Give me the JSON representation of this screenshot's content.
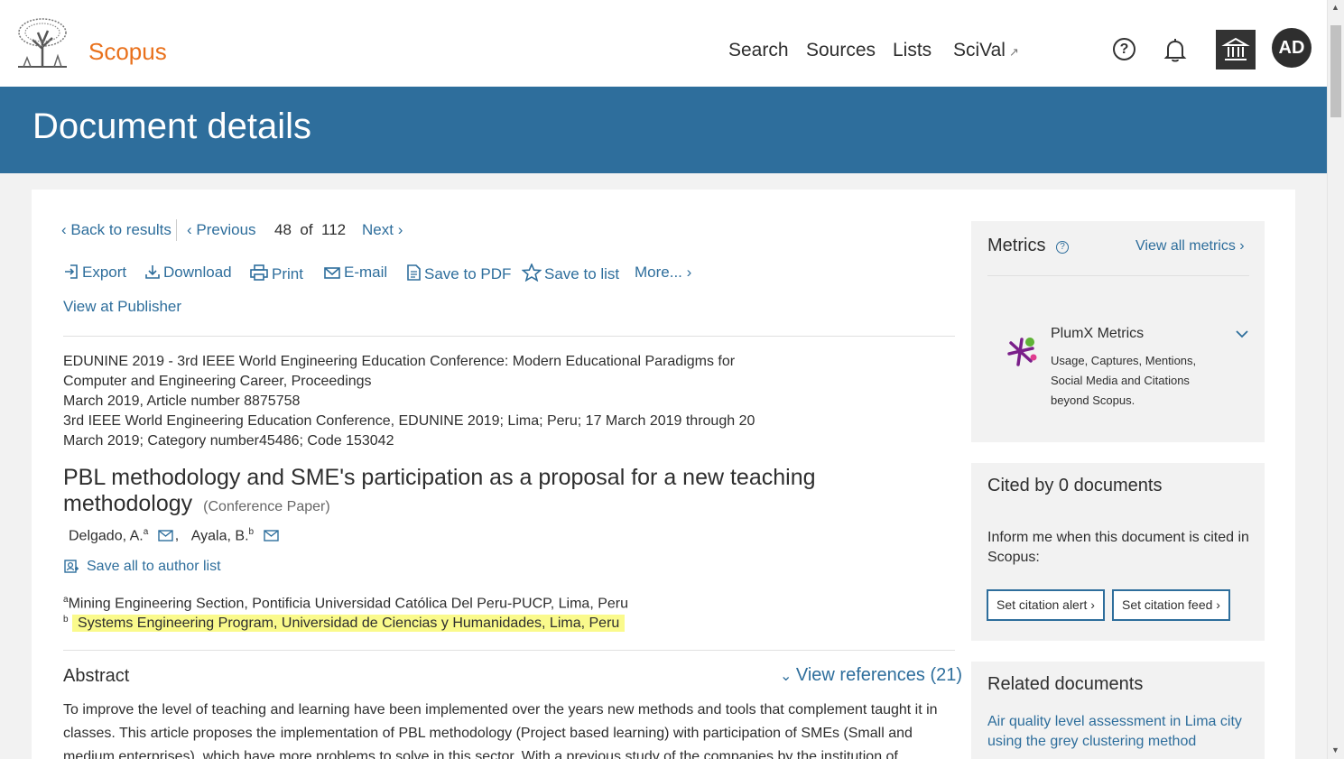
{
  "header": {
    "brand": "Scopus",
    "nav": {
      "search": "Search",
      "sources": "Sources",
      "lists": "Lists",
      "scival": "SciVal"
    },
    "avatar_initials": "AD",
    "icons": [
      "help-icon",
      "bell-icon",
      "institution-icon"
    ]
  },
  "banner": {
    "title": "Document details"
  },
  "results_nav": {
    "back": "Back to results",
    "previous": "Previous",
    "position": "48",
    "of": "of",
    "total": "112",
    "next": "Next"
  },
  "toolbar": {
    "export": "Export",
    "download": "Download",
    "print": "Print",
    "email": "E-mail",
    "save_pdf": "Save to PDF",
    "save_list": "Save to list",
    "more": "More..."
  },
  "view_publisher": "View at Publisher",
  "source": {
    "line1": "EDUNINE 2019 - 3rd IEEE World Engineering Education Conference: Modern Educational Paradigms for",
    "line2": "Computer and Engineering Career, Proceedings",
    "line3": "March 2019, Article number 8875758",
    "line4": "3rd IEEE World Engineering Education Conference, EDUNINE 2019; Lima; Peru; 17 March 2019 through 20",
    "line5": "March 2019; Category number45486; Code 153042"
  },
  "document": {
    "title_line1": "PBL methodology and SME's participation as a proposal for a new teaching",
    "title_line2": "methodology",
    "type": "(Conference Paper)"
  },
  "authors": [
    {
      "name": "Delgado, A.",
      "sup": "a"
    },
    {
      "name": "Ayala, B.",
      "sup": "b"
    }
  ],
  "save_author": "Save all to author list",
  "affiliations": [
    {
      "sup": "a",
      "text": "Mining Engineering Section, Pontificia Universidad Católica Del Peru-PUCP, Lima, Peru"
    },
    {
      "sup": "b",
      "text": "Systems Engineering Program, Universidad de Ciencias y Humanidades, Lima, Peru"
    }
  ],
  "abstract": {
    "heading": "Abstract",
    "view_refs": "View references (21)",
    "line1": "To improve the level of teaching and learning have been implemented over the years new methods and tools that complement taught it in",
    "line2": "classes. This article proposes the implementation of PBL methodology (Project based learning) with participation of SMEs (Small and",
    "line3": "medium enterprises), which have more problems to solve in this sector. With a previous study of the companies by the institution of"
  },
  "metrics": {
    "title": "Metrics",
    "view_all": "View all metrics",
    "plumx_title": "PlumX Metrics",
    "plumx_desc": "Usage, Captures, Mentions, Social Media and Citations beyond Scopus."
  },
  "cited": {
    "title": "Cited by 0 documents",
    "text": "Inform me when this document is cited in Scopus:",
    "alert_btn": "Set citation alert",
    "feed_btn": "Set citation feed"
  },
  "related": {
    "title": "Related documents",
    "link1": "Air quality level assessment in Lima city using the grey clustering method"
  },
  "colors": {
    "accent_blue": "#2e6e9c",
    "brand_orange": "#e9711c",
    "highlight": "#fafa8c"
  }
}
